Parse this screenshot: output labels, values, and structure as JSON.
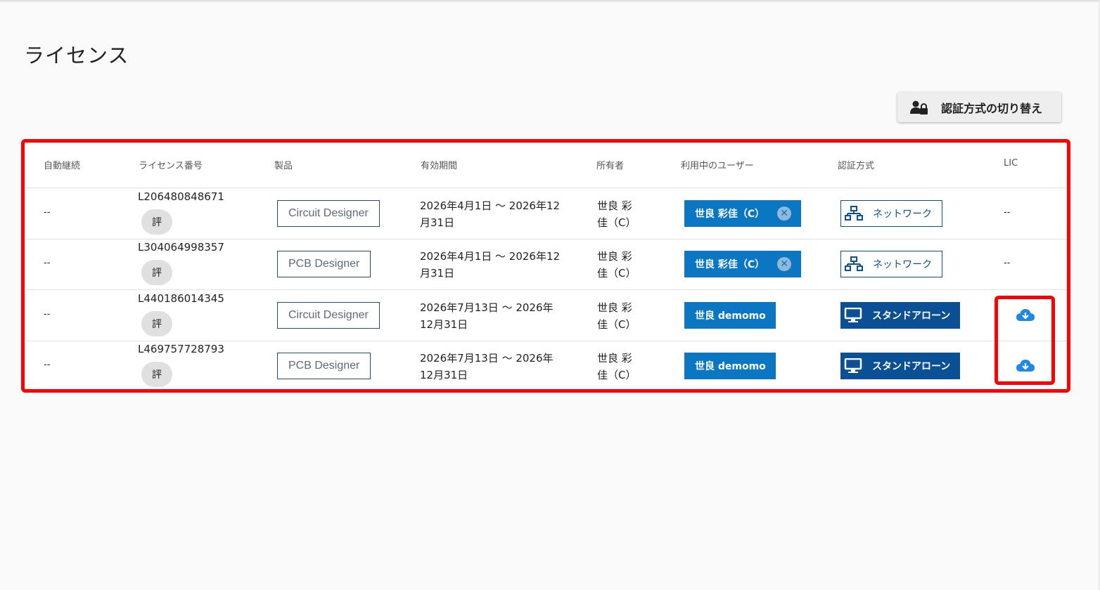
{
  "page": {
    "title": "ライセンス"
  },
  "toolbar": {
    "switch_auth_label": "認証方式の切り替え"
  },
  "table": {
    "headers": {
      "auto_renew": "自動継続",
      "license_number": "ライセンス番号",
      "product": "製品",
      "period": "有効期間",
      "owner": "所有者",
      "active_user": "利用中のユーザー",
      "auth_method": "認証方式",
      "lic": "LIC"
    },
    "rows": [
      {
        "auto_renew": "--",
        "license_number": "L206480848671",
        "eval_badge": "評",
        "product": "Circuit Designer",
        "period": "2026年4月1日 〜 2026年12月31日",
        "owner": "世良 彩佳（C）",
        "active_user": "世良 彩佳（C）",
        "user_removable": true,
        "auth_method": "ネットワーク",
        "auth_type": "network",
        "lic": "--"
      },
      {
        "auto_renew": "--",
        "license_number": "L304064998357",
        "eval_badge": "評",
        "product": "PCB Designer",
        "period": "2026年4月1日 〜 2026年12月31日",
        "owner": "世良 彩佳（C）",
        "active_user": "世良 彩佳（C）",
        "user_removable": true,
        "auth_method": "ネットワーク",
        "auth_type": "network",
        "lic": "--"
      },
      {
        "auto_renew": "--",
        "license_number": "L440186014345",
        "eval_badge": "評",
        "product": "Circuit Designer",
        "period": "2026年7月13日 〜 2026年12月31日",
        "owner": "世良 彩佳（C）",
        "active_user": "世良 demomo",
        "user_removable": false,
        "auth_method": "スタンドアローン",
        "auth_type": "standalone",
        "lic": "cloud-download-icon"
      },
      {
        "auto_renew": "--",
        "license_number": "L469757728793",
        "eval_badge": "評",
        "product": "PCB Designer",
        "period": "2026年7月13日 〜 2026年12月31日",
        "owner": "世良 彩佳（C）",
        "active_user": "世良 demomo",
        "user_removable": false,
        "auth_method": "スタンドアローン",
        "auth_type": "standalone",
        "lic": "cloud-download-icon"
      }
    ]
  },
  "colors": {
    "primary": "#0b77c2",
    "auth_dark": "#0b4f95",
    "highlight": "#ff0000",
    "download_icon": "#1e88e5"
  }
}
